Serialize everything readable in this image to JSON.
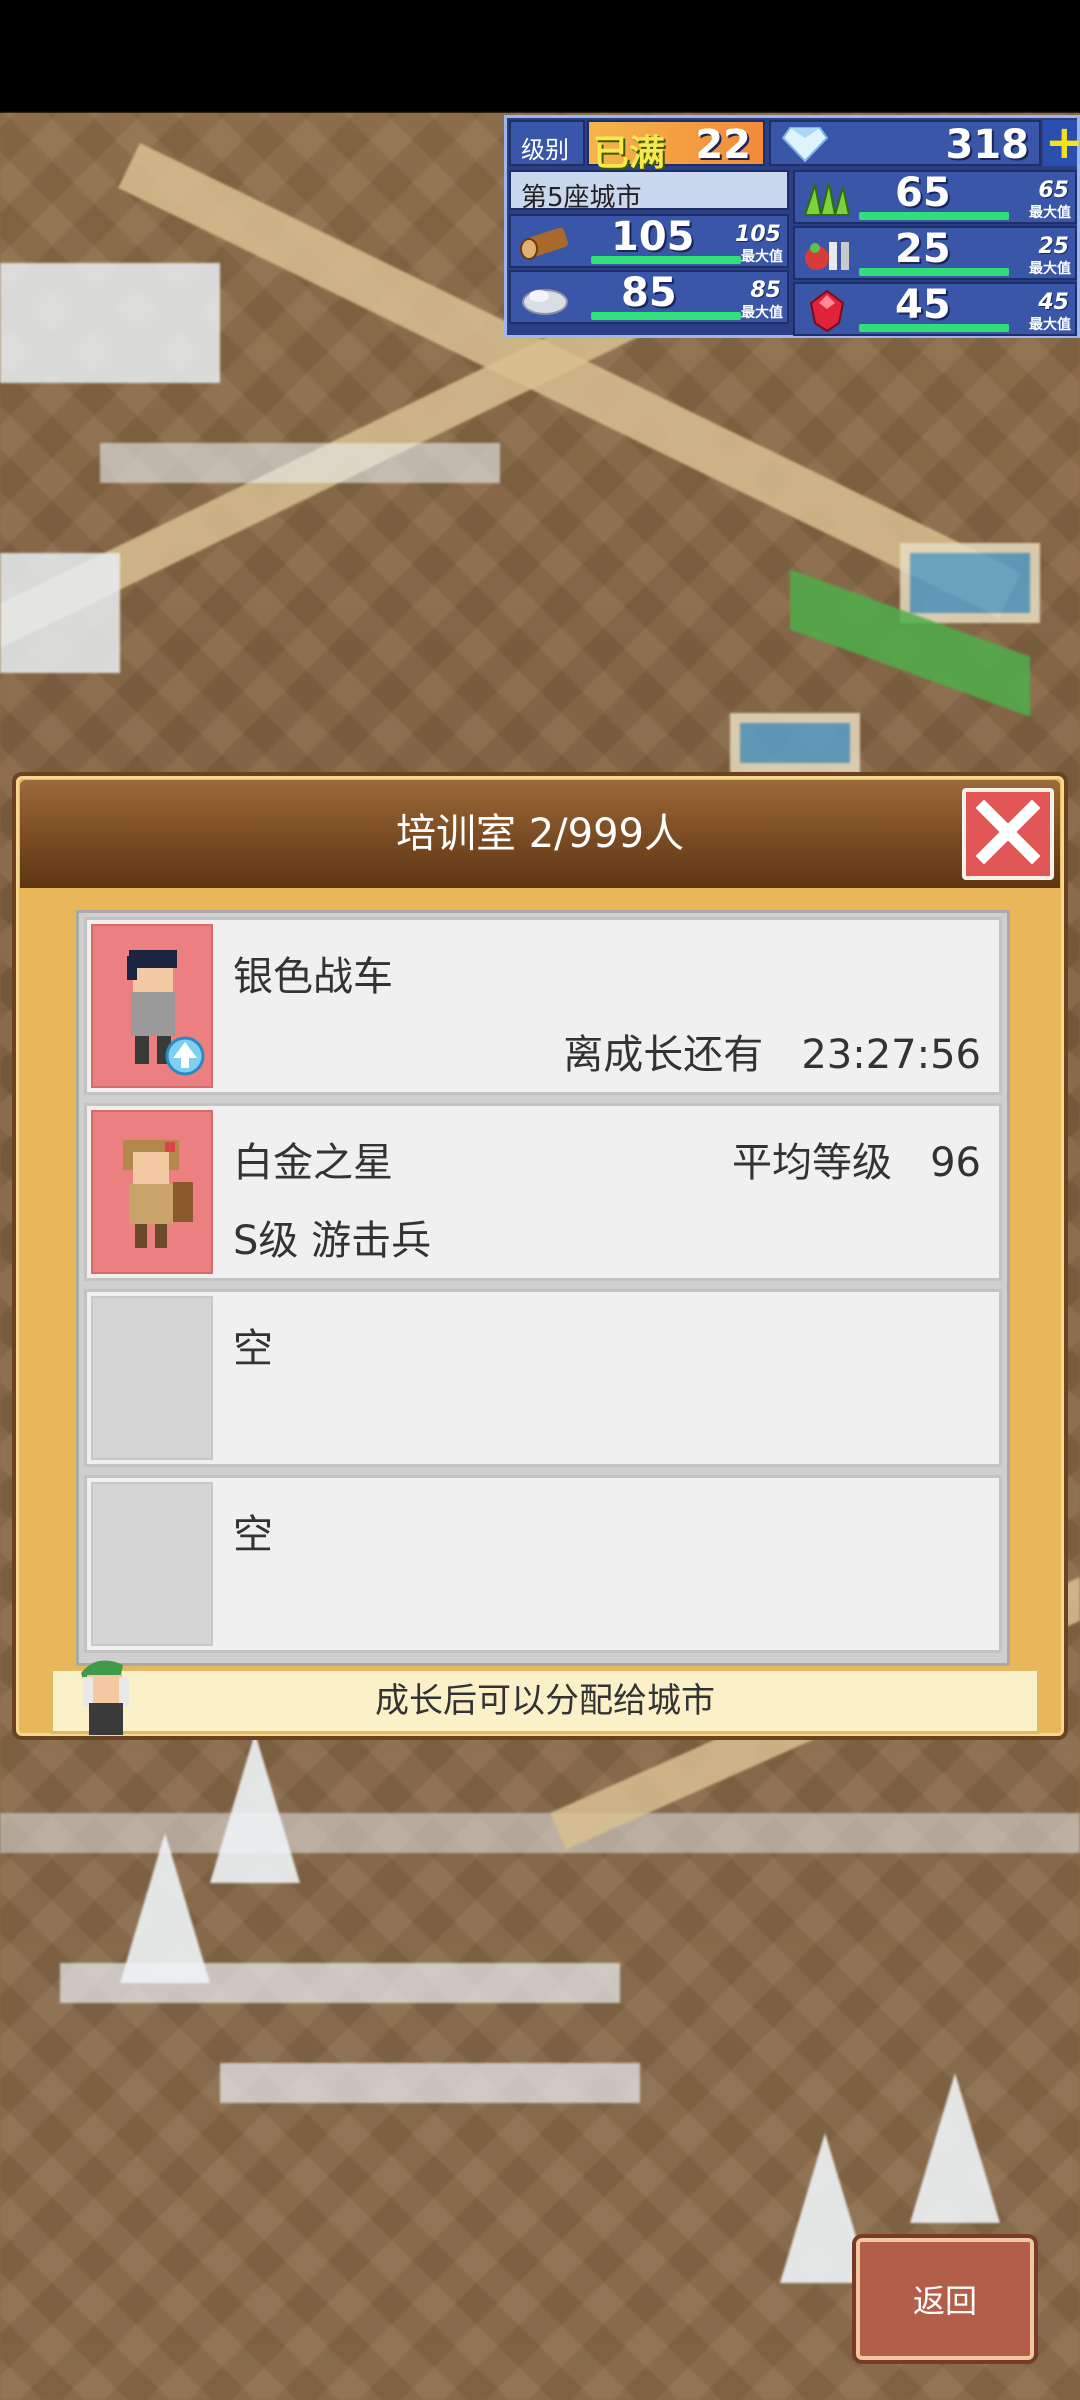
{
  "hud": {
    "level_label": "级别",
    "level_status": "已满",
    "level_value": "22",
    "gems": "318",
    "city_label": "第5座城市",
    "resources": [
      {
        "icon": "wood-log-icon",
        "value": "105",
        "max": "105",
        "fill": 1.0
      },
      {
        "icon": "stone-icon",
        "value": "85",
        "max": "85",
        "fill": 1.0
      },
      {
        "icon": "grass-icon",
        "value": "65",
        "max": "65",
        "fill": 1.0
      },
      {
        "icon": "food-icon",
        "value": "25",
        "max": "25",
        "fill": 1.0
      },
      {
        "icon": "ruby-icon",
        "value": "45",
        "max": "45",
        "fill": 1.0
      }
    ],
    "max_label": "最大值"
  },
  "dialog": {
    "title": "培训室 2/999人",
    "slots": [
      {
        "name": "银色战车",
        "right_label": "离成长还有   23:27:56",
        "sub": ""
      },
      {
        "name": "白金之星",
        "right_label": "平均等级   96",
        "sub": "S级 游击兵"
      },
      {
        "name": "空"
      },
      {
        "name": "空"
      }
    ],
    "tip": "成长后可以分配给城市"
  },
  "back_label": "返回",
  "colors": {
    "accent": "#e9b65a",
    "close": "#e25656",
    "portrait": "#ec7f7f"
  }
}
